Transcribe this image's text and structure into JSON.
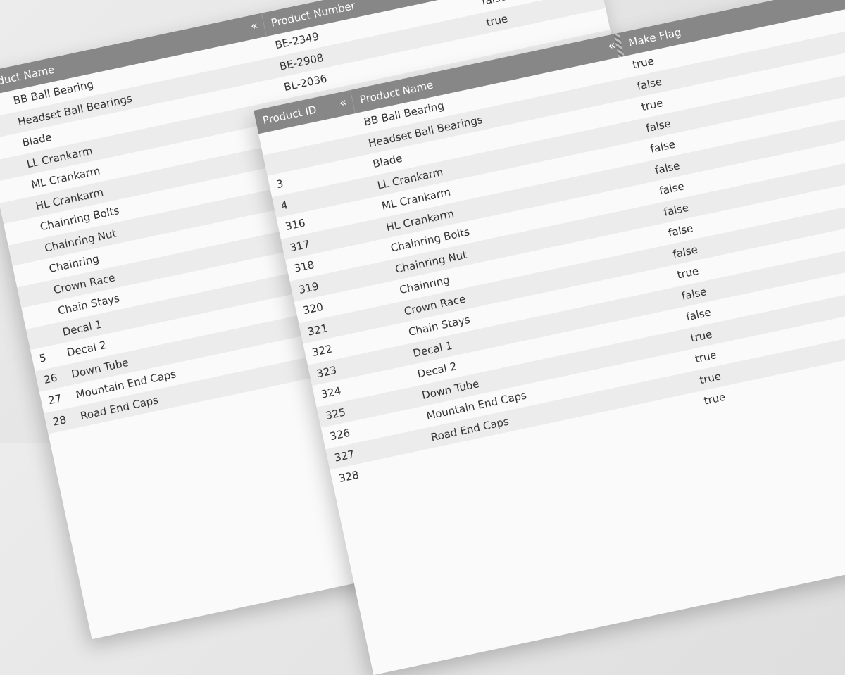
{
  "back_grid": {
    "headers": {
      "product_name": "Product Name",
      "product_number": "Product Number",
      "collapse_glyph": "«"
    },
    "rows": [
      {
        "id": "",
        "name": "BB Ball Bearing",
        "number": "BE-2349",
        "flag": "false"
      },
      {
        "id": "",
        "name": "Headset Ball Bearings",
        "number": "BE-2908",
        "flag": "true"
      },
      {
        "id": "",
        "name": "Blade",
        "number": "BL-2036",
        "flag": ""
      },
      {
        "id": "",
        "name": "LL Crankarm",
        "number": "",
        "flag": ""
      },
      {
        "id": "",
        "name": "ML Crankarm",
        "number": "",
        "flag": ""
      },
      {
        "id": "",
        "name": "HL Crankarm",
        "number": "",
        "flag": ""
      },
      {
        "id": "",
        "name": "Chainring Bolts",
        "number": "",
        "flag": ""
      },
      {
        "id": "",
        "name": "Chainring Nut",
        "number": "",
        "flag": ""
      },
      {
        "id": "",
        "name": "Chainring",
        "number": "",
        "flag": ""
      },
      {
        "id": "",
        "name": "Crown Race",
        "number": "",
        "flag": ""
      },
      {
        "id": "",
        "name": "Chain Stays",
        "number": "",
        "flag": ""
      },
      {
        "id": "",
        "name": "Decal 1",
        "number": "",
        "flag": ""
      },
      {
        "id": "5",
        "name": "Decal 2",
        "number": "",
        "flag": ""
      },
      {
        "id": "26",
        "name": "Down Tube",
        "number": "",
        "flag": ""
      },
      {
        "id": "27",
        "name": "Mountain End Caps",
        "number": "",
        "flag": ""
      },
      {
        "id": "28",
        "name": "Road End Caps",
        "number": "",
        "flag": ""
      }
    ]
  },
  "front_grid": {
    "headers": {
      "product_id": "Product ID",
      "product_name": "Product Name",
      "make_flag": "Make Flag",
      "collapse_glyph": "«"
    },
    "rows": [
      {
        "id": "",
        "name": "BB Ball Bearing",
        "flag": "true"
      },
      {
        "id": "",
        "name": "Headset Ball Bearings",
        "flag": "false"
      },
      {
        "id": "3",
        "name": "Blade",
        "flag": "true"
      },
      {
        "id": "4",
        "name": "LL Crankarm",
        "flag": "false"
      },
      {
        "id": "316",
        "name": "ML Crankarm",
        "flag": "false"
      },
      {
        "id": "317",
        "name": "HL Crankarm",
        "flag": "false"
      },
      {
        "id": "318",
        "name": "Chainring Bolts",
        "flag": "false"
      },
      {
        "id": "319",
        "name": "Chainring Nut",
        "flag": "false"
      },
      {
        "id": "320",
        "name": "Chainring",
        "flag": "false"
      },
      {
        "id": "321",
        "name": "Crown Race",
        "flag": "false"
      },
      {
        "id": "322",
        "name": "Chain Stays",
        "flag": "true"
      },
      {
        "id": "323",
        "name": "Decal 1",
        "flag": "false"
      },
      {
        "id": "324",
        "name": "Decal 2",
        "flag": "false"
      },
      {
        "id": "325",
        "name": "Down Tube",
        "flag": "true"
      },
      {
        "id": "326",
        "name": "Mountain End Caps",
        "flag": "true"
      },
      {
        "id": "327",
        "name": "Road End Caps",
        "flag": "true"
      },
      {
        "id": "328",
        "name": "",
        "flag": "true"
      }
    ]
  }
}
